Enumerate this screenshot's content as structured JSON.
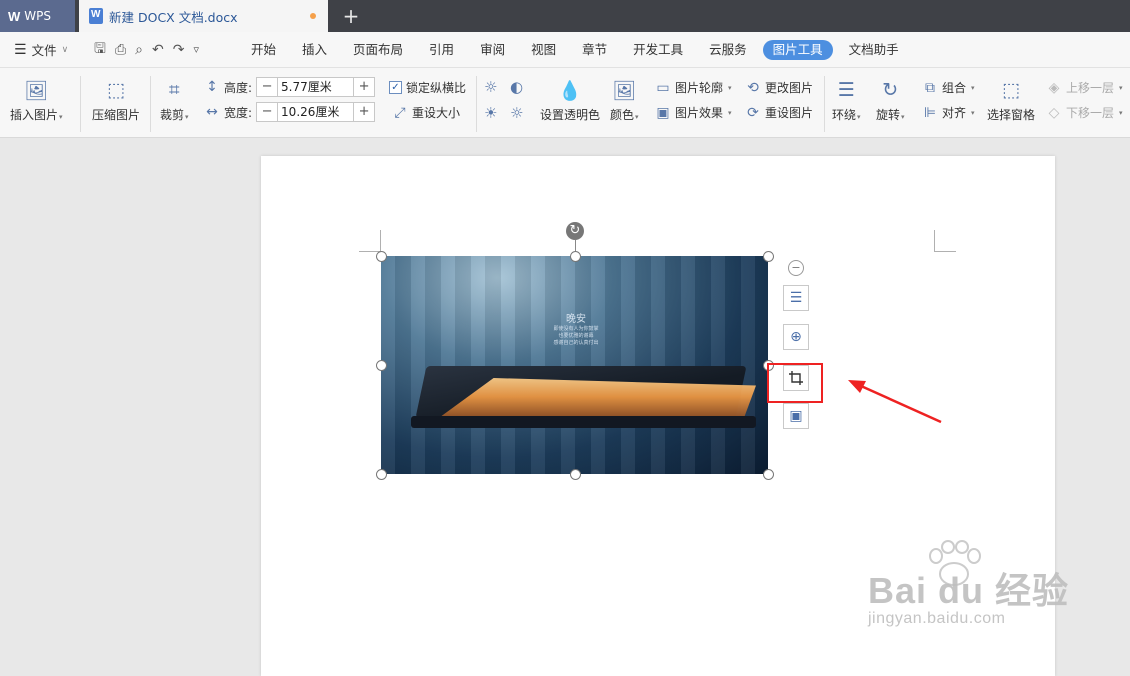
{
  "titlebar": {
    "app_tab": "WPS",
    "doc_tab": "新建 DOCX 文档.docx",
    "add_tab_icon": "plus-icon"
  },
  "menubar": {
    "file_label": "文件",
    "items": [
      "开始",
      "插入",
      "页面布局",
      "引用",
      "审阅",
      "视图",
      "章节",
      "开发工具",
      "云服务",
      "图片工具",
      "文档助手"
    ],
    "active": "图片工具"
  },
  "ribbon": {
    "insert_picture": "插入图片",
    "compress_picture": "压缩图片",
    "crop": "裁剪",
    "height_label": "高度:",
    "height_value": "5.77厘米",
    "width_label": "宽度:",
    "width_value": "10.26厘米",
    "lock_ratio": "锁定纵横比",
    "reset_size": "重设大小",
    "set_transparent": "设置透明色",
    "color": "颜色",
    "picture_outline": "图片轮廓",
    "picture_effects": "图片效果",
    "change_picture": "更改图片",
    "reset_picture": "重设图片",
    "wrap": "环绕",
    "rotate": "旋转",
    "group": "组合",
    "align": "对齐",
    "selection_pane": "选择窗格",
    "bring_forward": "上移一层",
    "send_backward": "下移一层"
  },
  "picture": {
    "title_text": "晚安",
    "line1": "即使没有人为你鼓掌",
    "line2": "也要优雅的谢幕",
    "line3": "感谢自己的认真付出"
  },
  "watermark": {
    "brand": "Bai du 经验",
    "url": "jingyan.baidu.com"
  },
  "colors": {
    "accent": "#4d8fe0",
    "highlight": "#ee2222",
    "titlebar": "#3f4147"
  }
}
